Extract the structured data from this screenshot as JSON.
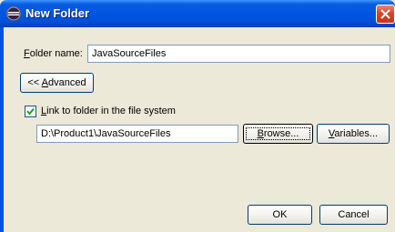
{
  "window": {
    "title": "New Folder"
  },
  "form": {
    "folder_name_label_first": "F",
    "folder_name_label_rest": "older name:",
    "folder_name_value": "JavaSourceFiles",
    "advanced_prefix": "<< ",
    "advanced_first": "A",
    "advanced_rest": "dvanced",
    "link_checkbox_checked": true,
    "link_label_first": "L",
    "link_label_rest": "ink to folder in the file system",
    "location_value": "D:\\Product1\\JavaSourceFiles",
    "browse_first": "B",
    "browse_rest": "rowse...",
    "variables_first": "V",
    "variables_rest": "ariables..."
  },
  "footer": {
    "ok_label": "OK",
    "cancel_label": "Cancel"
  },
  "icons": {
    "app": "eclipse-icon",
    "close": "close-icon",
    "check": "checkmark-icon"
  },
  "colors": {
    "titlebar": "#0054e3",
    "dialog_bg": "#ece9d8",
    "close": "#d8442a"
  }
}
